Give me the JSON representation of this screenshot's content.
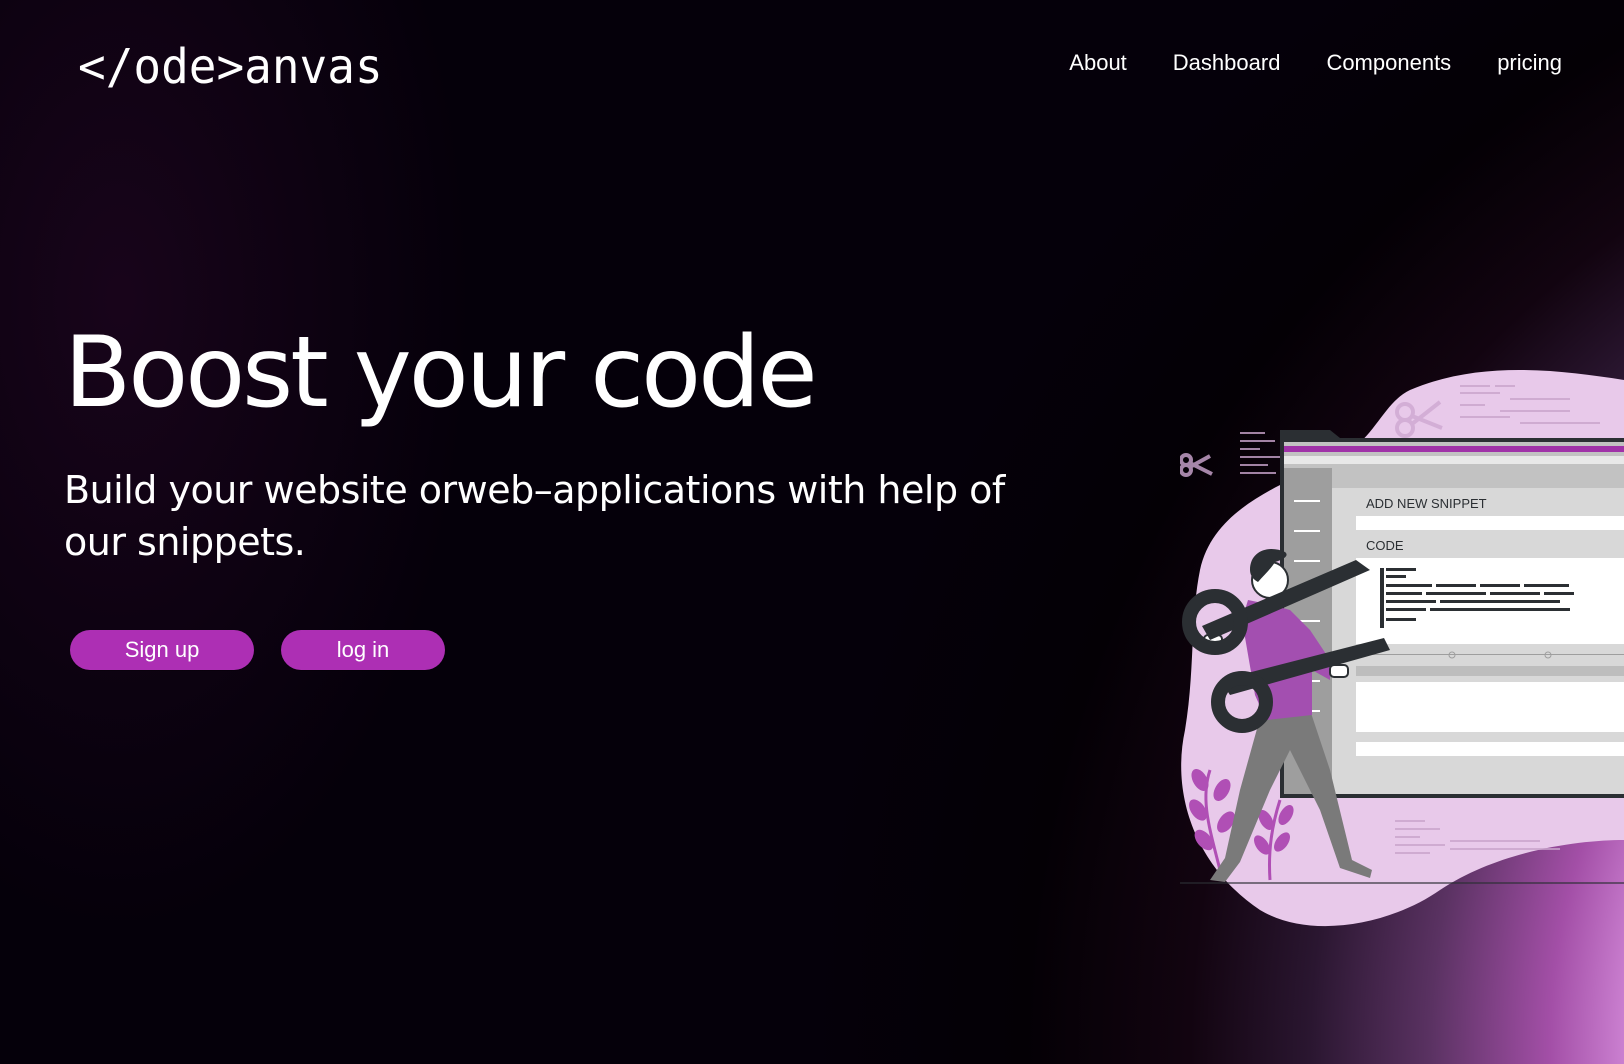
{
  "brand": {
    "logo_text": "</ode>anvas"
  },
  "nav": {
    "items": [
      {
        "label": "About"
      },
      {
        "label": "Dashboard"
      },
      {
        "label": "Components"
      },
      {
        "label": "pricing"
      }
    ]
  },
  "hero": {
    "title": "Boost your code",
    "subtitle": "Build your website orweb–applications with help of our snippets."
  },
  "buttons": {
    "signup_label": "Sign up",
    "login_label": "log in"
  },
  "illustration": {
    "form_title": "ADD NEW SNIPPET",
    "code_label": "CODE"
  },
  "colors": {
    "accent": "#ad2fb4",
    "illustration_blob": "#e8c9ea",
    "illustration_dark": "#2b2f33"
  }
}
